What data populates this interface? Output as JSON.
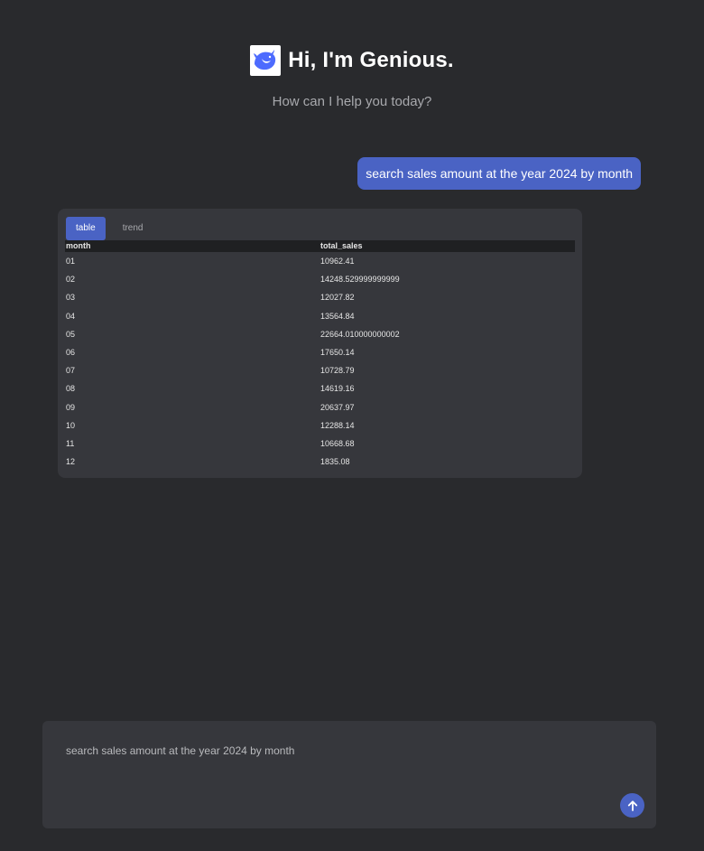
{
  "header": {
    "title": "Hi, I'm Genious.",
    "subtitle": "How can I help you today?",
    "logo_icon": "whale-logo-icon"
  },
  "conversation": {
    "user_message": "search sales amount at the year 2024 by month"
  },
  "result": {
    "tabs": [
      {
        "label": "table",
        "active": true
      },
      {
        "label": "trend",
        "active": false
      }
    ],
    "columns": [
      "month",
      "total_sales"
    ],
    "rows": [
      [
        "01",
        "10962.41"
      ],
      [
        "02",
        "14248.529999999999"
      ],
      [
        "03",
        "12027.82"
      ],
      [
        "04",
        "13564.84"
      ],
      [
        "05",
        "22664.010000000002"
      ],
      [
        "06",
        "17650.14"
      ],
      [
        "07",
        "10728.79"
      ],
      [
        "08",
        "14619.16"
      ],
      [
        "09",
        "20637.97"
      ],
      [
        "10",
        "12288.14"
      ],
      [
        "11",
        "10668.68"
      ],
      [
        "12",
        "1835.08"
      ]
    ]
  },
  "composer": {
    "value": "search sales amount at the year 2024 by month",
    "send_icon": "arrow-up-icon"
  },
  "colors": {
    "background": "#292a2d",
    "card": "#36373c",
    "accent": "#4a63c4"
  }
}
